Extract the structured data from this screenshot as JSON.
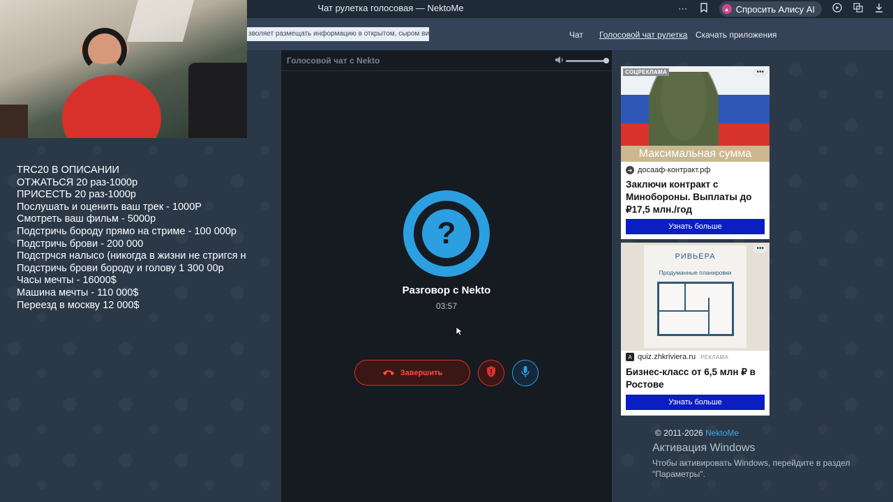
{
  "browser": {
    "title": "Чат рулетка голосовая — NektoMe",
    "alice_label": "Спросить Алису AI"
  },
  "site": {
    "cookie_note": "зволяет размещать информацию в открытом, сыром виде!",
    "nav": [
      {
        "label": "Чат"
      },
      {
        "label": "Голосовой чат рулетка"
      },
      {
        "label": "Скачать приложения"
      }
    ]
  },
  "overlay": {
    "lines": [
      "TRC20 В ОПИСАНИИ",
      "ОТЖАТЬСЯ 20 раз-1000р",
      "ПРИСЕСТЬ 20 раз-1000р",
      "Послушать и оценить ваш трек - 1000Р",
      "Смотреть ваш фильм - 5000р",
      "Подстричь бороду прямо на стриме - 100 000р",
      "Подстричь брови - 200 000",
      "Подстрчся налысо (никогда в жизни не стригся н",
      "Подстричь брови бороду и голову 1 300 00р",
      "Часы мечты - 16000$",
      "Машина мечты - 110 000$",
      "Переезд в москву 12 000$"
    ]
  },
  "chat": {
    "title": "Голосовой чат с Nekto",
    "volume_level": 1.0,
    "avatar_symbol": "?",
    "conversation_title": "Разговор с Nekto",
    "timer": "03:57",
    "end_label": "Завершить"
  },
  "ads": [
    {
      "badge": "СОЦРЕКЛАМА",
      "banner": "Максимальная сумма",
      "domain": "досааф-контракт.рф",
      "headline": "Заключи контракт с Минобороны. Выплаты до ₽17,5 млн./год",
      "cta": "Узнать больше"
    },
    {
      "brand": "РИВЬЕРА",
      "plan_caption": "Продуманные планировки",
      "domain": "quiz.zhkriviera.ru",
      "tag": "РЕКЛАМА",
      "headline": "Бизнес-класс от 6,5 млн ₽ в Ростове",
      "cta": "Узнать больше"
    }
  ],
  "footer": {
    "copyright": "© 2011-2026",
    "link": "NektoMe",
    "windows_title": "Активация Windows",
    "windows_sub": "Чтобы активировать Windows, перейдите в раздел \"Параметры\"."
  },
  "colors": {
    "accent": "#2b9fe0",
    "danger": "#d9302c",
    "cta": "#0b1ec2",
    "panel": "#161b22",
    "header": "#354358"
  }
}
